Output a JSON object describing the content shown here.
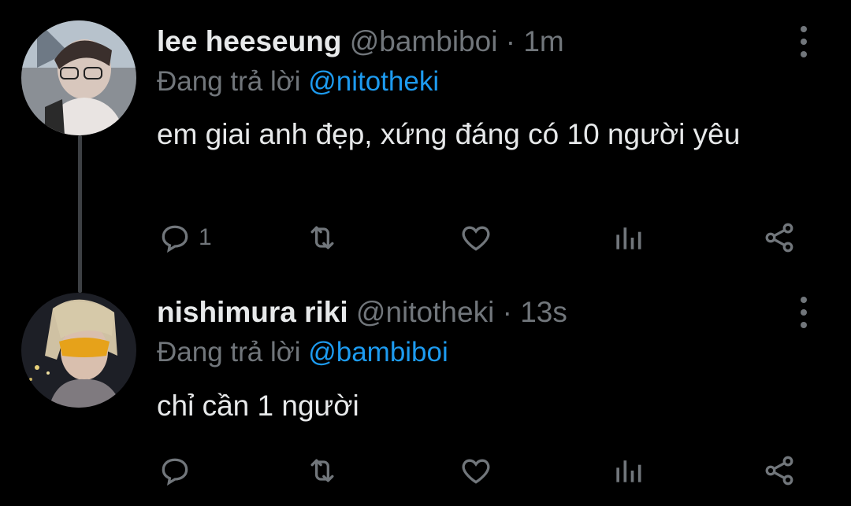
{
  "colors": {
    "background": "#000000",
    "muted": "#71767b",
    "link": "#1d9bf0",
    "text": "#e7e9ea"
  },
  "tweets": [
    {
      "name": "lee heeseung",
      "handle": "@bambiboi",
      "separator": "·",
      "time": "1m",
      "replying_prefix": "Đang trả lời",
      "replying_to": "@nitotheki",
      "text": "em giai anh đẹp, xứng đáng có 10 người yêu",
      "reply_count": "1",
      "avatar": "avatar-photo"
    },
    {
      "name": "nishimura riki",
      "handle": "@nitotheki",
      "separator": "·",
      "time": "13s",
      "replying_prefix": "Đang trả lời",
      "replying_to": "@bambiboi",
      "text": "chỉ cần 1 người",
      "reply_count": "",
      "avatar": "avatar-photo"
    }
  ],
  "icons": [
    "reply-icon",
    "retweet-icon",
    "like-icon",
    "analytics-icon",
    "share-icon",
    "more-options-icon"
  ]
}
